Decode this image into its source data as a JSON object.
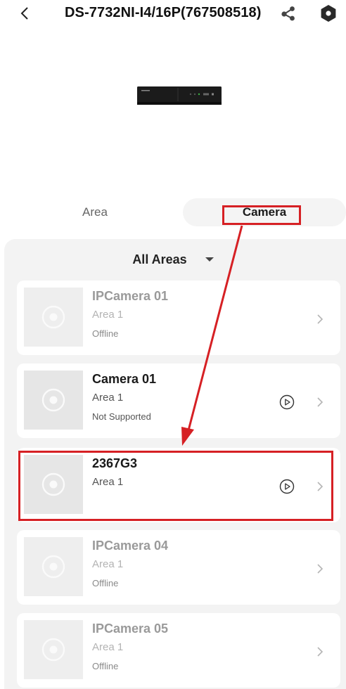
{
  "header": {
    "back_icon": "chevron-left-icon",
    "title": "DS-7732NI-I4/16P(767508518)",
    "share_icon": "share-icon",
    "settings_icon": "settings-icon"
  },
  "device": {
    "image": "nvr-device-image"
  },
  "tabs": [
    {
      "label": "Area",
      "selected": false
    },
    {
      "label": "Camera",
      "selected": true
    }
  ],
  "filter": {
    "label": "All Areas"
  },
  "cameras": [
    {
      "name": "IPCamera 01",
      "area": "Area 1",
      "status": "Offline",
      "playable": false,
      "offline": true
    },
    {
      "name": "Camera 01",
      "area": "Area 1",
      "status": "Not Supported",
      "playable": true,
      "offline": false
    },
    {
      "name": "2367G3",
      "area": "Area 1",
      "status": "",
      "playable": true,
      "offline": false
    },
    {
      "name": "IPCamera 04",
      "area": "Area 1",
      "status": "Offline",
      "playable": false,
      "offline": true
    },
    {
      "name": "IPCamera 05",
      "area": "Area 1",
      "status": "Offline",
      "playable": false,
      "offline": true
    }
  ],
  "colors": {
    "annotation": "#d62024",
    "panel_background": "#f3f3f3",
    "selected_tab_background": "#f4f4f4"
  }
}
